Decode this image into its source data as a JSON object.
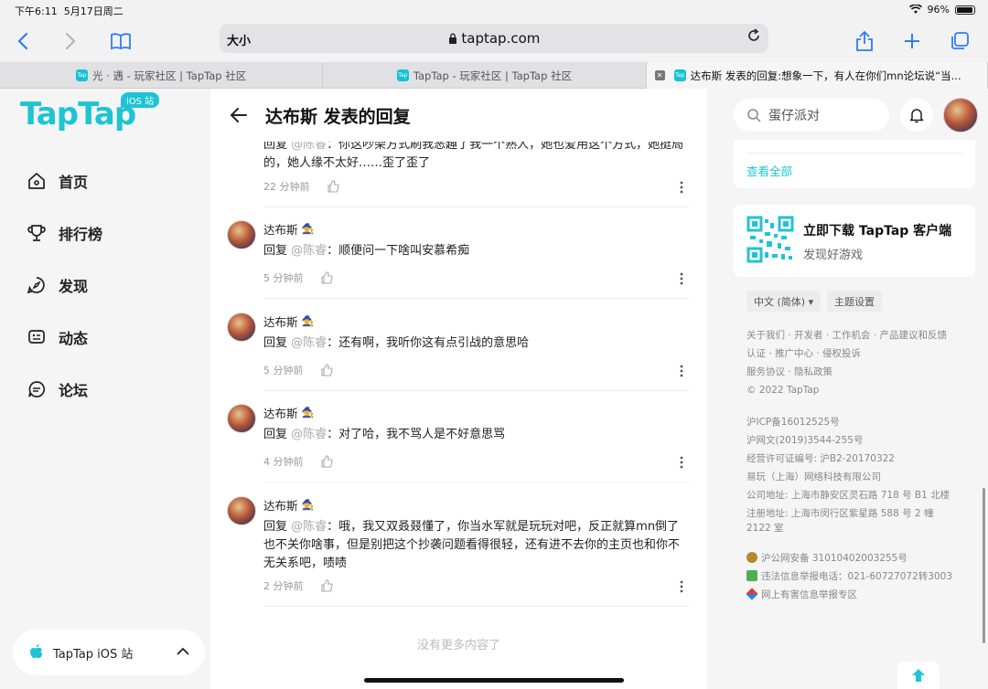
{
  "status_bar": {
    "time": "下午6:11",
    "date": "5月17日周二",
    "battery": "96%"
  },
  "browser": {
    "text_size": "大小",
    "url": "taptap.com"
  },
  "tabs": [
    {
      "label": "光 · 遇 - 玩家社区 | TapTap 社区"
    },
    {
      "label": "TapTap - 玩家社区 | TapTap 社区"
    },
    {
      "label": "达布斯 发表的回复:想象一下，有人在你们mn论坛说“当..."
    }
  ],
  "sidebar": {
    "logo": "TapTap",
    "badge": "iOS 站",
    "items": [
      {
        "label": "首页",
        "icon": "home-icon"
      },
      {
        "label": "排行榜",
        "icon": "trophy-icon"
      },
      {
        "label": "发现",
        "icon": "discover-icon"
      },
      {
        "label": "动态",
        "icon": "feed-icon"
      },
      {
        "label": "论坛",
        "icon": "forum-icon"
      }
    ],
    "site_switch": "TapTap iOS 站"
  },
  "main": {
    "title": "达布斯 发表的回复",
    "partial": {
      "line1_prefix": "回复 ",
      "line1_at": "@陈睿",
      "line1_text": "：你这吵架方式刷我恶趣了我一个熟人，她也爱用这个方式，她挺局",
      "line2": "的，她人缘不太好……歪了歪了",
      "time": "22 分钟前"
    },
    "replies": [
      {
        "name": "达布斯",
        "prefix": "回复 ",
        "at": "@陈睿",
        "text": "：顺便问一下啥叫安慕希痴",
        "time": "5 分钟前"
      },
      {
        "name": "达布斯",
        "prefix": "回复 ",
        "at": "@陈睿",
        "text": "：还有啊，我听你这有点引战的意思哈",
        "time": "5 分钟前"
      },
      {
        "name": "达布斯",
        "prefix": "回复 ",
        "at": "@陈睿",
        "text": "：对了哈，我不骂人是不好意思骂",
        "time": "4 分钟前"
      },
      {
        "name": "达布斯",
        "prefix": "回复 ",
        "at": "@陈睿",
        "text": "：哦，我又双叒叕懂了，你当水军就是玩玩对吧，反正就算mn倒了也不关你啥事，但是别把这个抄袭问题看得很轻，还有进不去你的主页也和你不无关系吧，啧啧",
        "time": "2 分钟前"
      }
    ],
    "no_more": "没有更多内容了"
  },
  "right": {
    "search_placeholder": "蛋仔派对",
    "view_all": "查看全部",
    "download_title": "立即下载 TapTap 客户端",
    "download_sub": "发现好游戏",
    "language": "中文 (简体) ▾",
    "theme": "主题设置",
    "footer": [
      "关于我们 · 开发者 · 工作机会 · 产品建议和反馈",
      "认证 · 推广中心 · 侵权投诉",
      "服务协议 · 隐私政策",
      "© 2022 TapTap",
      "沪ICP备16012525号",
      "沪网文(2019)3544-255号",
      "经营许可证编号: 沪B2-20170322",
      "易玩（上海）网络科技有限公司",
      "公司地址: 上海市静安区灵石路 718 号 B1 北楼",
      "注册地址: 上海市闵行区紫星路 588 号 2 幢",
      "2122 室",
      "沪公网安备 31010402003255号",
      "违法信息举报电话：021-60727072转3003",
      "网上有害信息举报专区"
    ]
  },
  "colors": {
    "brand": "#1ec4d4",
    "safari_blue": "#2f7cf6"
  }
}
